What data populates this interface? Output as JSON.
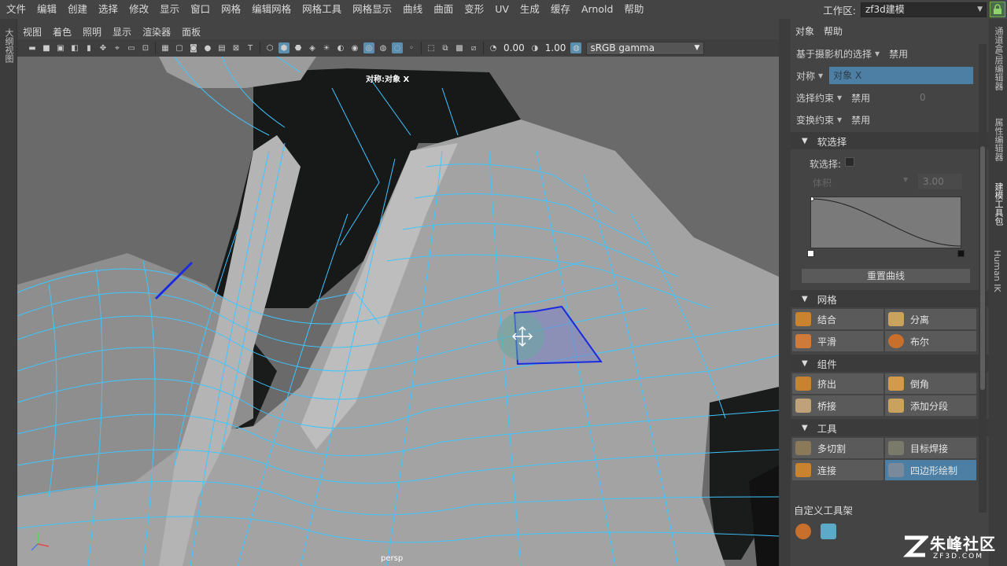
{
  "menubar": {
    "items": [
      "文件",
      "编辑",
      "创建",
      "选择",
      "修改",
      "显示",
      "窗口",
      "网格",
      "编辑网格",
      "网格工具",
      "网格显示",
      "曲线",
      "曲面",
      "变形",
      "UV",
      "生成",
      "缓存",
      "Arnold",
      "帮助"
    ]
  },
  "workspace": {
    "label": "工作区:",
    "value": "zf3d建模"
  },
  "left_tab": {
    "label": "大纲视图"
  },
  "viewport": {
    "panel_menu": [
      "视图",
      "着色",
      "照明",
      "显示",
      "渲染器",
      "面板"
    ],
    "exposure": "0.00",
    "gamma": "1.00",
    "color_space": "sRGB gamma",
    "title": "对称:对象 X",
    "camera": "persp"
  },
  "right_panel": {
    "menu": [
      "对象",
      "帮助"
    ],
    "camera_select": {
      "label": "基于摄影机的选择",
      "value": "禁用"
    },
    "symmetry": {
      "label": "对称",
      "value": "对象 X"
    },
    "select_constraint": {
      "label": "选择约束",
      "value": "禁用",
      "extra": "0"
    },
    "transform_constraint": {
      "label": "变换约束",
      "value": "禁用"
    },
    "soft_select": {
      "title": "软选择",
      "checkbox_label": "软选择:",
      "falloff_mode": "体积",
      "radius": "3.00",
      "reset_button": "重置曲线"
    },
    "mesh": {
      "title": "网格",
      "buttons": [
        "结合",
        "分离",
        "平滑",
        "布尔"
      ]
    },
    "components": {
      "title": "组件",
      "buttons": [
        "挤出",
        "倒角",
        "桥接",
        "添加分段"
      ]
    },
    "tools": {
      "title": "工具",
      "buttons": [
        "多切割",
        "目标焊接",
        "连接",
        "四边形绘制"
      ],
      "selected": "四边形绘制"
    },
    "custom_shelf": "自定义工具架"
  },
  "right_tabs": [
    "通道盒/层编辑器",
    "属性编辑器",
    "建模工具包",
    "Human IK"
  ],
  "watermark": {
    "name": "朱峰社区",
    "url": "ZF3D.COM"
  },
  "colors": {
    "accent": "#4c7fa3",
    "wire": "#3ec6ff",
    "selection": "#2233ee"
  }
}
